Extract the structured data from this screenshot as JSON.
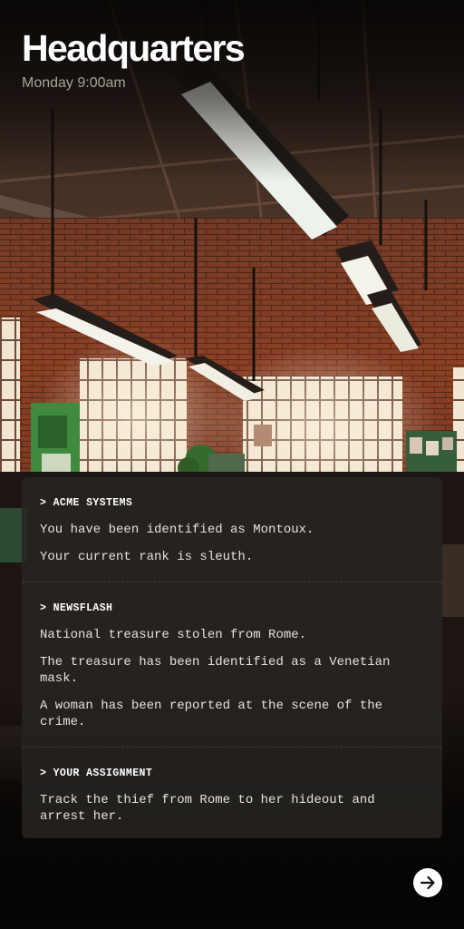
{
  "header": {
    "title": "Headquarters",
    "subtitle": "Monday 9:00am"
  },
  "briefing": {
    "sections": [
      {
        "heading": "> ACME SYSTEMS",
        "lines": [
          "You have been identified as Montoux.",
          "Your current rank is sleuth."
        ]
      },
      {
        "heading": "> NEWSFLASH",
        "lines": [
          "National treasure stolen from Rome.",
          "The treasure has been identified as a Venetian mask.",
          "A woman has been reported at the scene of the crime."
        ]
      },
      {
        "heading": "> YOUR ASSIGNMENT",
        "lines": [
          "Track the thief from Rome to her hideout and arrest her."
        ]
      }
    ]
  },
  "next_button": {
    "icon": "arrow-right-icon"
  },
  "colors": {
    "card_background": "#262422",
    "title": "#ffffff",
    "subtitle": "#a9a39c",
    "brick": "#8a3f26",
    "window_light": "#f3eadb"
  }
}
